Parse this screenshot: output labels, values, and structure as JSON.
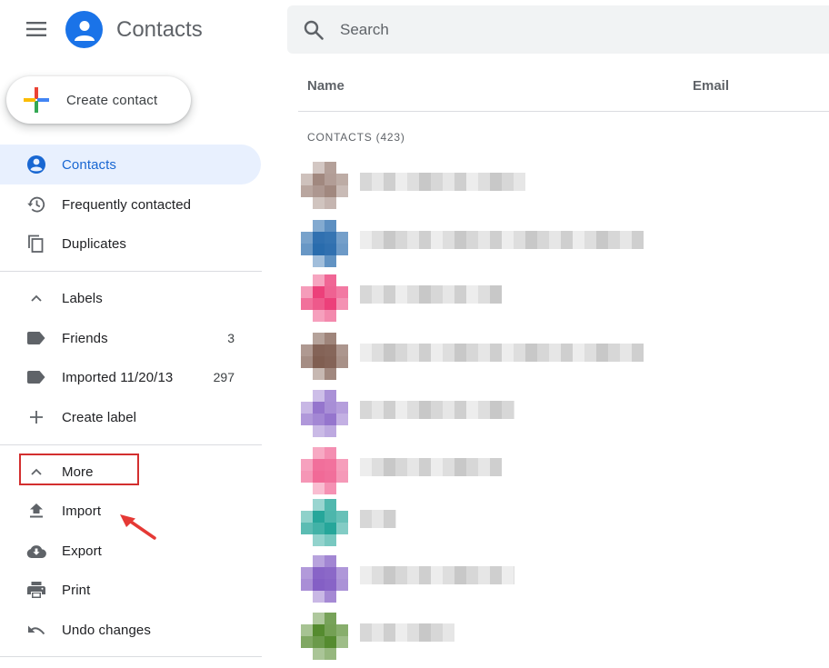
{
  "header": {
    "app_title": "Contacts",
    "menu_icon": "hamburger-menu-icon",
    "logo_icon": "person-icon",
    "brand_color": "#1a73e8"
  },
  "search": {
    "placeholder": "Search",
    "value": "",
    "icon": "search-icon"
  },
  "create": {
    "label": "Create contact",
    "icon": "multicolor-plus-icon"
  },
  "sidebar": {
    "primary": [
      {
        "label": "Contacts",
        "icon": "person-circle-icon",
        "active": true
      },
      {
        "label": "Frequently contacted",
        "icon": "history-icon",
        "active": false
      },
      {
        "label": "Duplicates",
        "icon": "copy-icon",
        "active": false
      }
    ],
    "labels_section": {
      "label": "Labels",
      "icon": "chevron-up-icon"
    },
    "labels": [
      {
        "label": "Friends",
        "count": "3",
        "icon": "label-icon"
      },
      {
        "label": "Imported 11/20/13",
        "count": "297",
        "icon": "label-icon"
      }
    ],
    "create_label": {
      "label": "Create label",
      "icon": "plus-icon"
    },
    "more_section": {
      "label": "More",
      "icon": "chevron-up-icon"
    },
    "more": [
      {
        "label": "Import",
        "icon": "upload-icon"
      },
      {
        "label": "Export",
        "icon": "cloud-download-icon"
      },
      {
        "label": "Print",
        "icon": "printer-icon"
      },
      {
        "label": "Undo changes",
        "icon": "undo-icon"
      }
    ]
  },
  "main": {
    "columns": [
      "Name",
      "Email"
    ],
    "section_label": "CONTACTS (423)",
    "rows": [
      {
        "avatar_color": "#a1887f",
        "name": "[redacted]",
        "email": ""
      },
      {
        "avatar_color": "#1e64a9",
        "name": "[redacted]",
        "email": ""
      },
      {
        "avatar_color": "#ec407a",
        "name": "[redacted]",
        "email": ""
      },
      {
        "avatar_color": "#795548",
        "name": "[redacted]",
        "email": ""
      },
      {
        "avatar_color": "#9575cd",
        "name": "[redacted]",
        "email": ""
      },
      {
        "avatar_color": "#f06292",
        "name": "[redacted]",
        "email": ""
      },
      {
        "avatar_color": "#26a69a",
        "name": "[redacted]",
        "email": ""
      },
      {
        "avatar_color": "#7e57c2",
        "name": "[redacted]",
        "email": ""
      },
      {
        "avatar_color": "#558b2f",
        "name": "[redacted]",
        "email": ""
      }
    ]
  },
  "annotations": {
    "highlight_color": "#d32f2f",
    "arrow_color": "#e53935"
  }
}
